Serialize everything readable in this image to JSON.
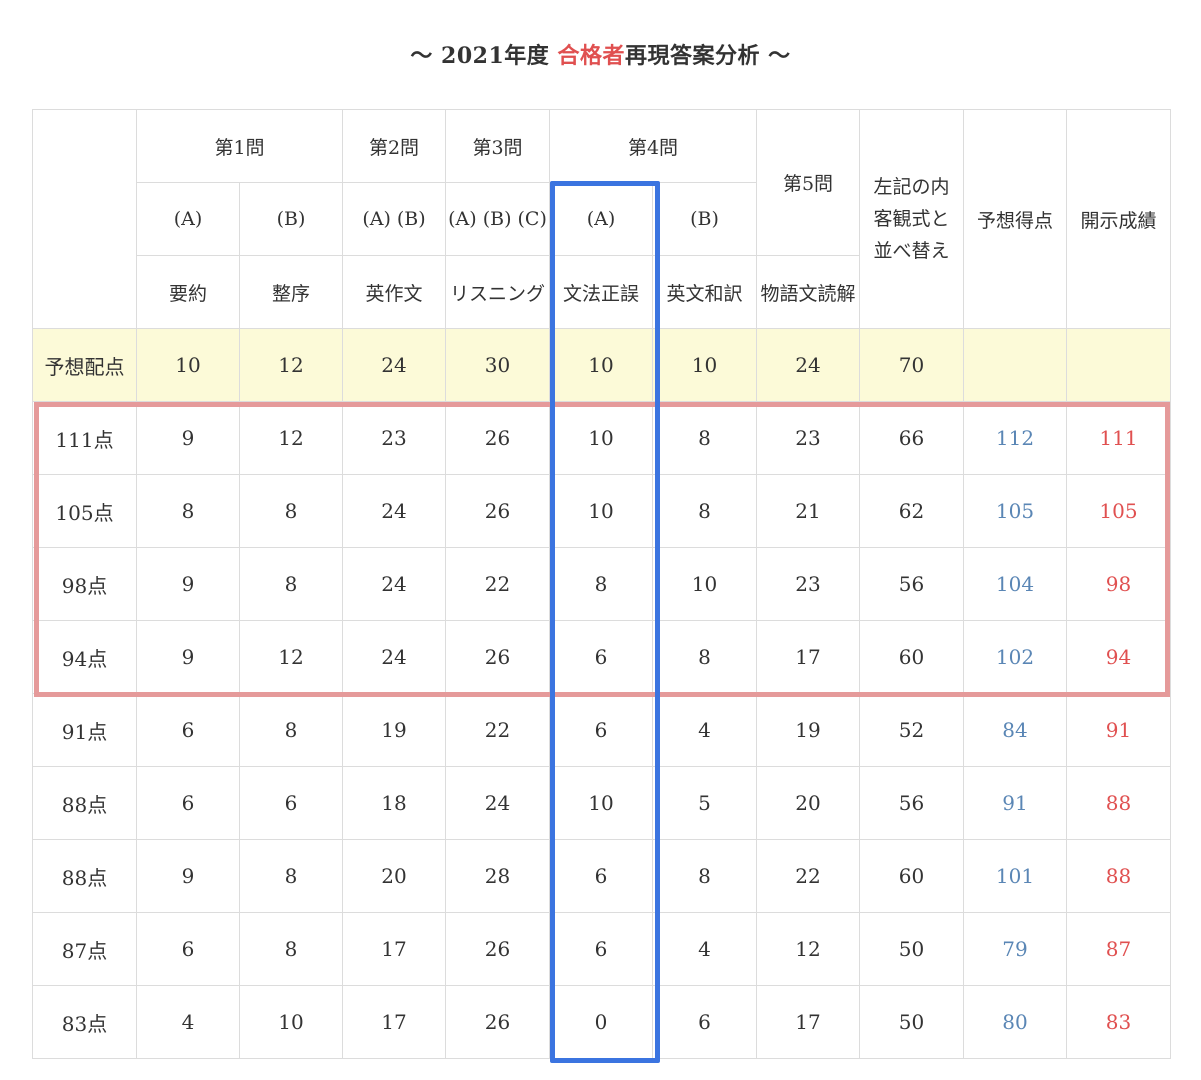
{
  "title": {
    "prefix": "〜 2021年度 ",
    "accent": "合格者",
    "suffix": "再現答案分析 〜"
  },
  "header": {
    "q1": "第1問",
    "q2": "第2問",
    "q3": "第3問",
    "q4": "第4問",
    "q5": "第5問",
    "objective_sort": "左記の内客観式と並べ替え",
    "predicted": "予想得点",
    "official": "開示成績",
    "q1a": "(A)",
    "q1b": "(B)",
    "q2ab": "(A) (B)",
    "q3abc": "(A) (B) (C)",
    "q4a": "(A)",
    "q4b": "(B)",
    "q1a_name": "要約",
    "q1b_name": "整序",
    "q2_name": "英作文",
    "q3_name": "リスニング",
    "q4a_name": "文法正誤",
    "q4b_name": "英文和訳",
    "q5_name": "物語文読解"
  },
  "expected": {
    "label": "予想配点",
    "values": [
      "10",
      "12",
      "24",
      "30",
      "10",
      "10",
      "24",
      "70",
      "",
      ""
    ]
  },
  "rows": [
    {
      "label": "111点",
      "values": [
        "9",
        "12",
        "23",
        "26",
        "10",
        "8",
        "23",
        "66"
      ],
      "predicted": "112",
      "official": "111"
    },
    {
      "label": "105点",
      "values": [
        "8",
        "8",
        "24",
        "26",
        "10",
        "8",
        "21",
        "62"
      ],
      "predicted": "105",
      "official": "105"
    },
    {
      "label": "98点",
      "values": [
        "9",
        "8",
        "24",
        "22",
        "8",
        "10",
        "23",
        "56"
      ],
      "predicted": "104",
      "official": "98"
    },
    {
      "label": "94点",
      "values": [
        "9",
        "12",
        "24",
        "26",
        "6",
        "8",
        "17",
        "60"
      ],
      "predicted": "102",
      "official": "94"
    },
    {
      "label": "91点",
      "values": [
        "6",
        "8",
        "19",
        "22",
        "6",
        "4",
        "19",
        "52"
      ],
      "predicted": "84",
      "official": "91"
    },
    {
      "label": "88点",
      "values": [
        "6",
        "6",
        "18",
        "24",
        "10",
        "5",
        "20",
        "56"
      ],
      "predicted": "91",
      "official": "88"
    },
    {
      "label": "88点",
      "values": [
        "9",
        "8",
        "20",
        "28",
        "6",
        "8",
        "22",
        "60"
      ],
      "predicted": "101",
      "official": "88"
    },
    {
      "label": "87点",
      "values": [
        "6",
        "8",
        "17",
        "26",
        "6",
        "4",
        "12",
        "50"
      ],
      "predicted": "79",
      "official": "87"
    },
    {
      "label": "83点",
      "values": [
        "4",
        "10",
        "17",
        "26",
        "0",
        "6",
        "17",
        "50"
      ],
      "predicted": "80",
      "official": "83"
    }
  ],
  "colors": {
    "accent_red": "#e05050",
    "predicted_blue": "#5a86b5",
    "highlight_blue": "#3b74e0",
    "highlight_pink": "#e59a9a",
    "expected_row_bg": "#fcfad8"
  }
}
